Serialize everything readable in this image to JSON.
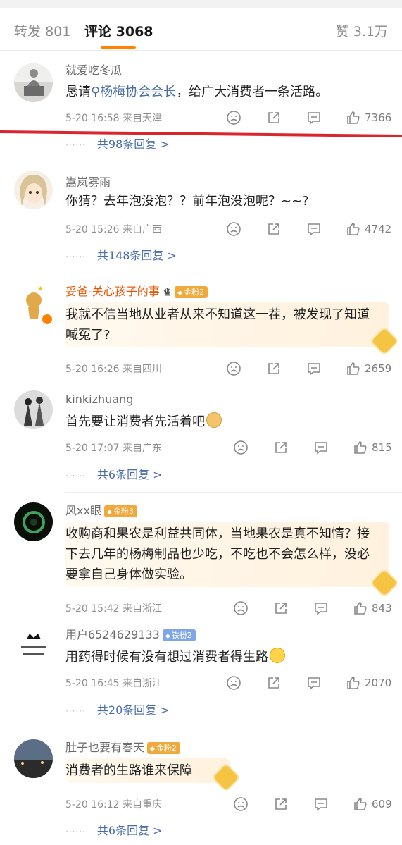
{
  "tabs": {
    "repost_label": "转发",
    "repost_count": "801",
    "comment_label": "评论",
    "comment_count": "3068",
    "like_label": "赞",
    "like_count": "3.1万"
  },
  "comments": [
    {
      "user": "就爱吃冬瓜",
      "text_pre": "恳请",
      "topic": "杨梅协会会长",
      "text_post": "，给广大消费者一条活路。",
      "meta": "5-20 16:58  来自天津",
      "likes": "7366",
      "replies": "共98条回复 >"
    },
    {
      "user": "嵩岚雾雨",
      "text": "你猜？去年泡没泡？？前年泡没泡呢？~~?",
      "meta": "5-20 15:26  来自广西",
      "likes": "4742",
      "replies": "共148条回复 >"
    },
    {
      "user": "妥爸-关心孩子的事",
      "fan": "金粉2",
      "text": "我就不信当地从业者从来不知道这一茬，被发现了知道喊冤了?",
      "meta": "5-20 16:26  来自四川",
      "likes": "2659"
    },
    {
      "user": "kinkizhuang",
      "text": "首先要让消费者先活着吧",
      "meta": "5-20 17:07  来自广东",
      "likes": "815",
      "replies": "共6条回复 >"
    },
    {
      "user": "风xx眼",
      "fan": "金粉3",
      "text": "收购商和果农是利益共同体，当地果农是真不知情？接下去几年的杨梅制品也少吃，不吃也不会怎么样，没必要拿自己身体做实验。",
      "meta": "5-20 15:42  来自浙江",
      "likes": "843"
    },
    {
      "user": "用户6524629133",
      "fan": "铁粉2",
      "text": "用药得时候有没有想过消费者得生路",
      "meta": "5-20 16:45  来自浙江",
      "likes": "2070",
      "replies": "共20条回复 >"
    },
    {
      "user": "肚子也要有春天",
      "fan": "金粉2",
      "text": "消费者的生路谁来保障",
      "meta": "5-20 16:12  来自重庆",
      "likes": "609",
      "replies": "共6条回复 >"
    }
  ],
  "colors": {
    "accent": "#ff8200",
    "link": "#4a6ea9",
    "annotation_line": "#d9252b"
  },
  "icons": [
    "search-icon",
    "dislike-icon",
    "share-icon",
    "reply-icon",
    "like-icon",
    "medal-icon",
    "crown-icon"
  ]
}
